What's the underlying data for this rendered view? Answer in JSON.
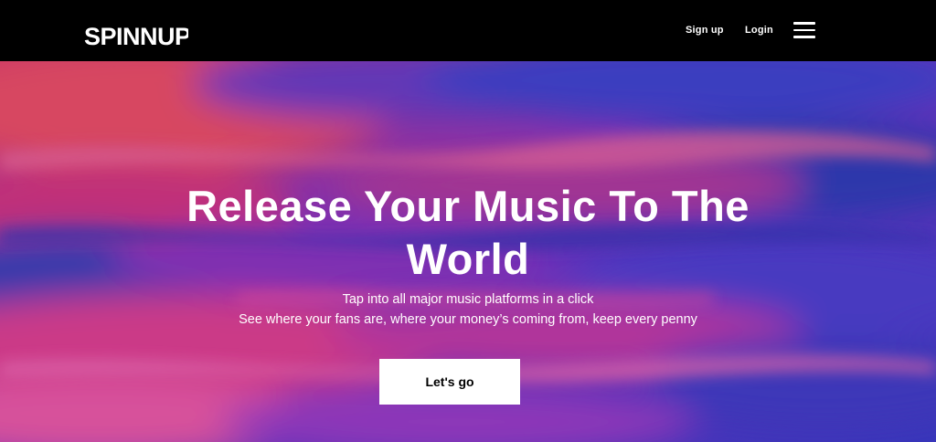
{
  "nav": {
    "logo_text": "SPINNUP",
    "signup_label": "Sign up",
    "login_label": "Login",
    "menu_icon": "hamburger-menu-icon"
  },
  "hero": {
    "headline_line1": "Release Your Music To The",
    "headline_line2": "World",
    "subline_1": "Tap into all major music platforms in a click",
    "subline_2": "See where your fans are, where your money’s coming from, keep every penny",
    "cta_label": "Let's go"
  },
  "colors": {
    "nav_background": "#000000",
    "hero_pink": "#e0357e",
    "hero_blue": "#3437c4",
    "hero_purple": "#6a2ac8",
    "button_background": "#ffffff"
  }
}
